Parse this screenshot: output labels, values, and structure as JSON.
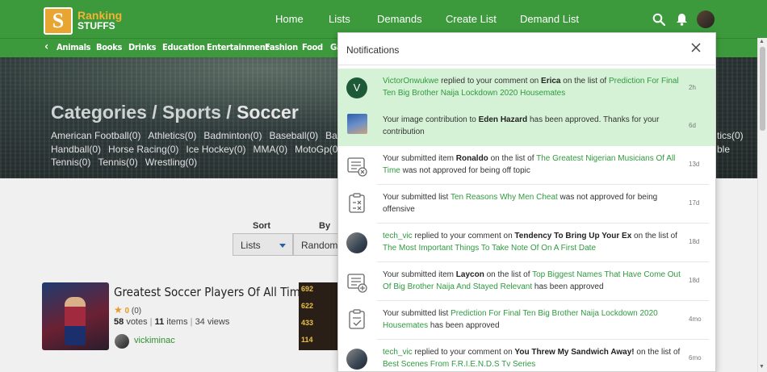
{
  "brand": {
    "line1": "Ranking",
    "line2": "STUFFS",
    "mark": "S"
  },
  "nav": {
    "home": "Home",
    "lists": "Lists",
    "demands": "Demands",
    "create_list": "Create List",
    "demand_list": "Demand List"
  },
  "categories": [
    "Animals",
    "Books",
    "Drinks",
    "Education",
    "Entertainment",
    "Fashion",
    "Food",
    "Ga"
  ],
  "hero": {
    "crumb1": "Categories",
    "crumb2": "Sports",
    "crumb3": "Soccer",
    "sep": "/",
    "row1": [
      "American Football(0)",
      "Athletics(0)",
      "Badminton(0)",
      "Baseball(0)",
      "Bask"
    ],
    "row2": [
      "Handball(0)",
      "Horse Racing(0)",
      "Ice Hockey(0)",
      "MMA(0)",
      "MotoGp(0)",
      "O"
    ],
    "row3": [
      "Tennis(0)",
      "Tennis(0)",
      "Wrestling(0)"
    ],
    "right1": "tics(0)",
    "right2": "ble"
  },
  "sort": {
    "sort_label": "Sort",
    "by_label": "By",
    "sort_value": "Lists",
    "by_value": "Random"
  },
  "list_card": {
    "title": "Greatest Soccer Players Of All Time",
    "rating": "0",
    "rating_count": "(0)",
    "votes": "58",
    "votes_label": "votes",
    "items": "11",
    "items_label": "items",
    "views": "34 views",
    "sep": "|",
    "user": "vickiminac"
  },
  "card2_numbers": [
    "692",
    "622",
    "433",
    "114"
  ],
  "notifications": {
    "title": "Notifications",
    "items": [
      {
        "p1": "VictorOnwukwe",
        "p2": " replied to your comment on ",
        "p3": "Erica",
        "p4": " on the list of ",
        "p5": "Prediction For Final Ten Big Brother Naija Lockdown 2020 Housemates",
        "time": "2h",
        "avatar": "V"
      },
      {
        "p1": "Your image contribution to ",
        "p2": "Eden Hazard",
        "p3": " has been approved. Thanks for your contribution",
        "time": "6d"
      },
      {
        "p1": "Your submitted item ",
        "p2": "Ronaldo",
        "p3": " on the list of ",
        "p4": "The Greatest Nigerian Musicians Of All Time",
        "p5": " was not approved for being off topic",
        "time": "13d"
      },
      {
        "p1": "Your submitted list ",
        "p2": "Ten Reasons Why Men Cheat",
        "p3": " was not approved for being offensive",
        "time": "17d"
      },
      {
        "p1": "tech_vic",
        "p2": " replied to your comment on ",
        "p3": "Tendency To Bring Up Your Ex",
        "p4": " on the list of ",
        "p5": "The Most Important Things To Take Note Of On A First Date",
        "time": "18d"
      },
      {
        "p1": "Your submitted item ",
        "p2": "Laycon",
        "p3": " on the list of ",
        "p4": "Top Biggest Names That Have Come Out Of Big Brother Naija And Stayed Relevant",
        "p5": " has been approved",
        "time": "18d"
      },
      {
        "p1": "Your submitted list ",
        "p2": "Prediction For Final Ten Big Brother Naija Lockdown 2020 Housemates",
        "p3": " has been approved",
        "time": "4mo"
      },
      {
        "p1": "tech_vic",
        "p2": " replied to your comment on ",
        "p3": "You Threw My Sandwich Away!",
        "p4": " on the list of ",
        "p5": "Best Scenes From F.R.I.E.N.D.S Tv Series",
        "time": "6mo"
      }
    ]
  },
  "colors": {
    "brand_green": "#3c9a3c",
    "accent_orange": "#e9a531",
    "unread_bg": "#d6f2d6",
    "link_green": "#2f9a3f"
  },
  "icons": [
    "search-icon",
    "bell-icon",
    "close-icon",
    "chevron-left-icon",
    "star-icon",
    "caret-down-icon",
    "clipboard-x-icon",
    "clipboard-check-icon"
  ]
}
